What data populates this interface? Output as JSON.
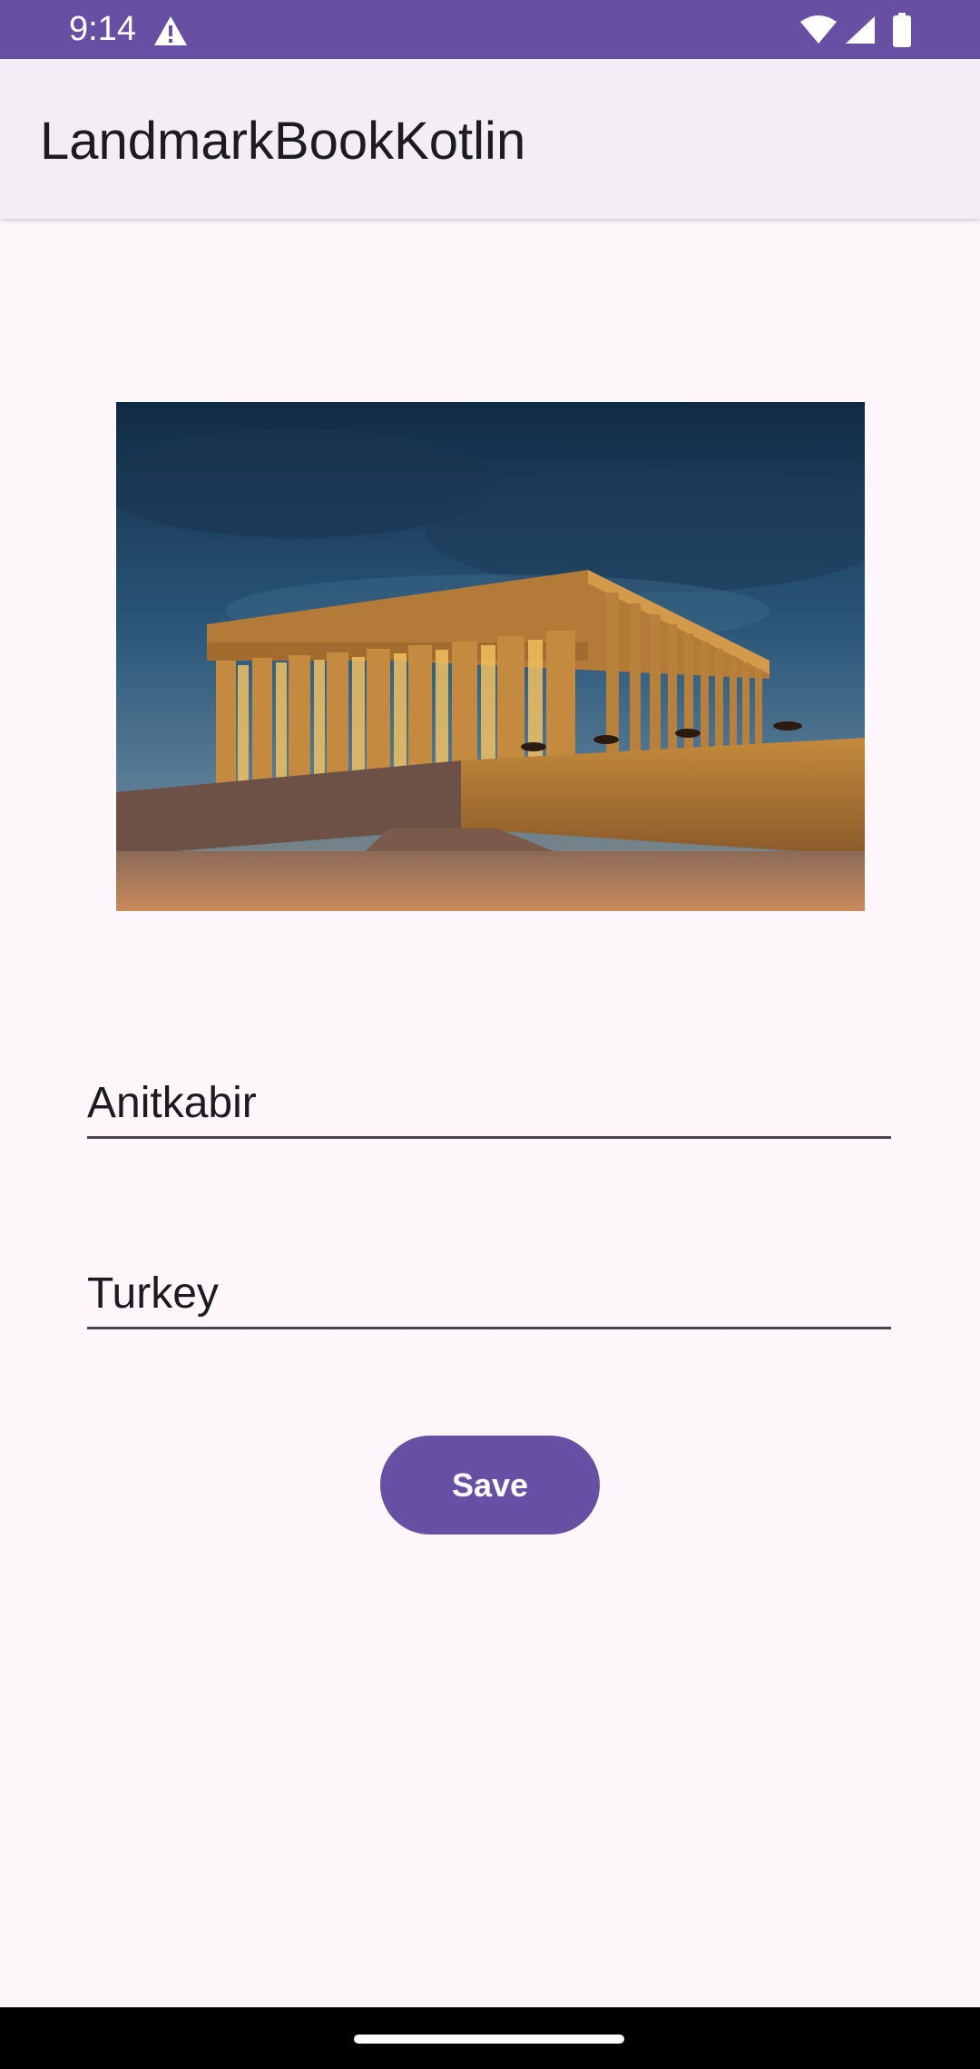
{
  "status_bar": {
    "time": "9:14",
    "icons": [
      "warning-icon",
      "wifi-icon",
      "signal-icon",
      "battery-icon"
    ],
    "color": "#6750a4"
  },
  "app_bar": {
    "title": "LandmarkBookKotlin"
  },
  "landmark": {
    "image_icon": "landmark-photo",
    "name": "Anitkabir",
    "country": "Turkey"
  },
  "actions": {
    "save_label": "Save"
  },
  "colors": {
    "accent": "#6750a4",
    "background": "#fdf7fc",
    "app_bar": "#f3edf6"
  }
}
